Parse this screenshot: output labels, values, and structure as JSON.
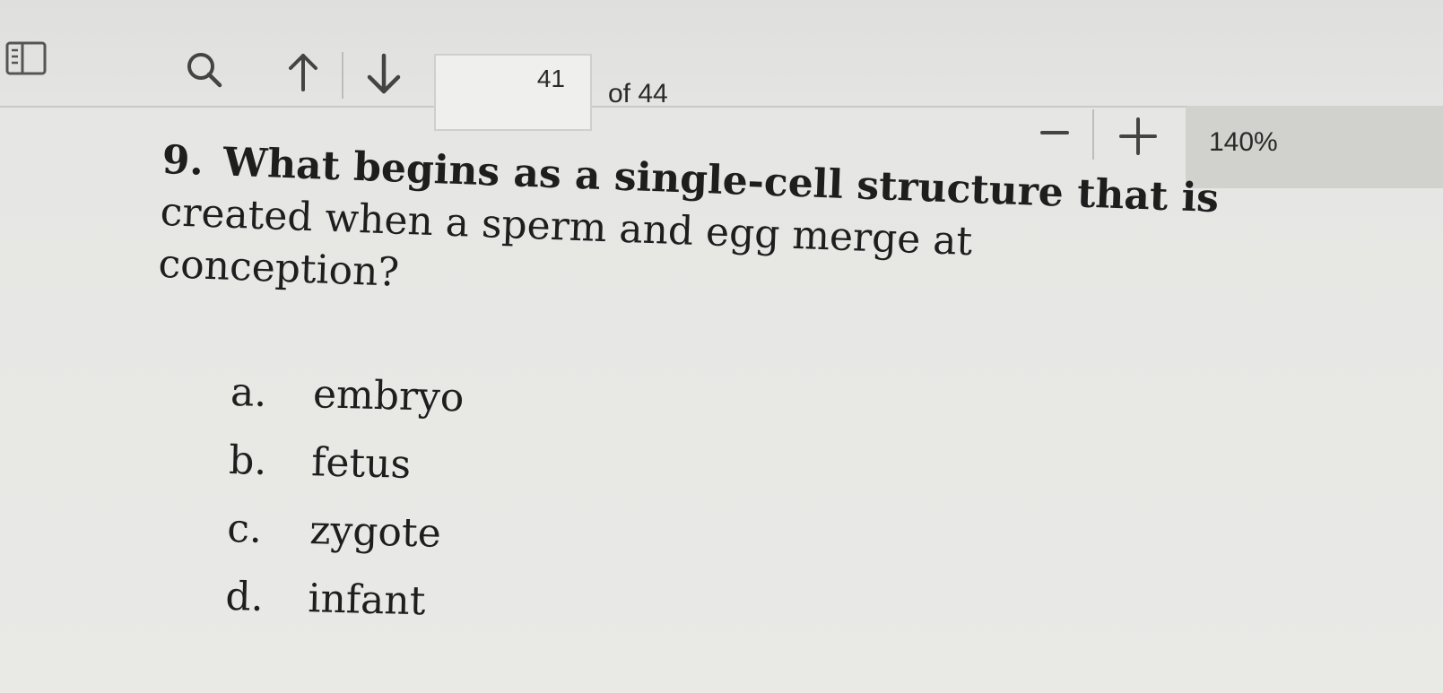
{
  "toolbar": {
    "current_page": "41",
    "page_total": "of 44",
    "zoom_level": "140%",
    "icons": {
      "sidebar": "sidebar-toggle-icon",
      "search": "search-icon",
      "prev": "arrow-up-icon",
      "next": "arrow-down-icon",
      "zoom_out": "minus-icon",
      "zoom_in": "plus-icon"
    }
  },
  "question": {
    "number": "9.",
    "lines": [
      "What begins as a single-cell structure that is",
      "created when a sperm and egg merge at",
      "conception?"
    ]
  },
  "options": [
    {
      "letter": "a.",
      "text": "embryo"
    },
    {
      "letter": "b.",
      "text": "fetus"
    },
    {
      "letter": "c.",
      "text": "zygote"
    },
    {
      "letter": "d.",
      "text": "infant"
    }
  ],
  "colors": {
    "background": "#e6e6e4",
    "toolbar": "#e1e1df",
    "text": "#1e1e1e",
    "zoom_box": "#d1d1ce"
  }
}
